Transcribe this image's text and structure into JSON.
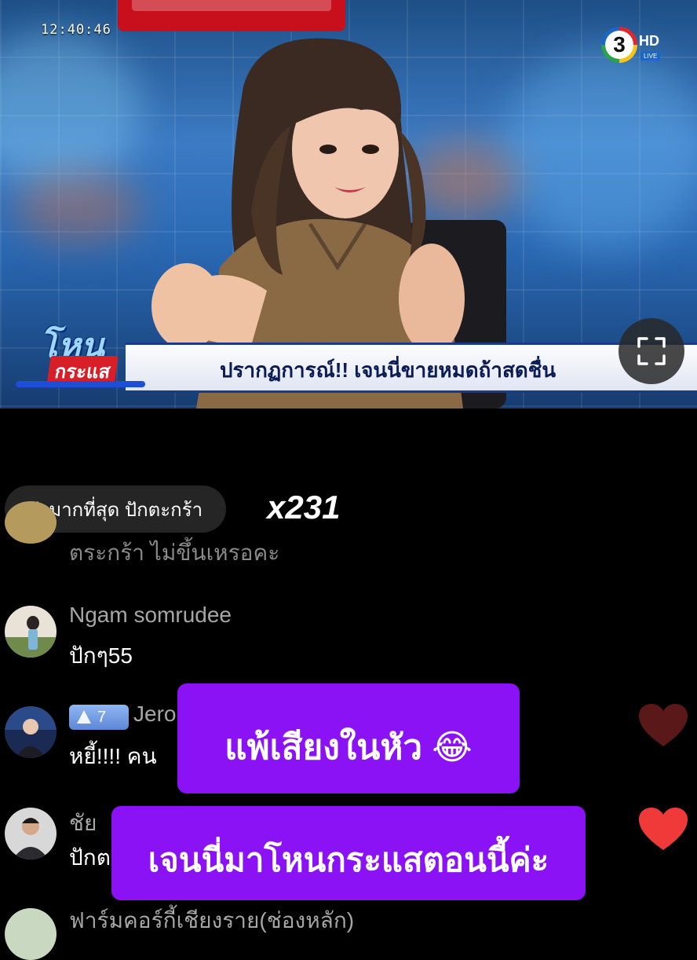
{
  "video": {
    "timestamp": "12:40:46",
    "channel_logo": {
      "number": "3",
      "hd": "HD",
      "live": "LIVE"
    },
    "show_logo": {
      "top": "โหน",
      "bottom": "กระแส"
    },
    "ticker_text": "ปรากฏการณ์!!  เจนนี่ขายหมดถ้าสดชื่น",
    "fullscreen_icon": "fullscreen-icon"
  },
  "top_gifter": {
    "label": "ส่งมากที่สุด ปักตะกร้า",
    "combo": "x231"
  },
  "comments": [
    {
      "user": "",
      "message": "ตระกร้า ไม่ขึ้นเหรอคะ"
    },
    {
      "user": "Ngam somrudee",
      "message": "ปักๆ55"
    },
    {
      "user": "Jero",
      "user_tail": ")",
      "badge_level": "7",
      "message": "หยี้!!!! คน"
    },
    {
      "user": "ชัย",
      "message": "ปักต"
    },
    {
      "user": "ฟาร์มคอร์กี้เชียงราย(ช่องหลัก)",
      "message": ""
    }
  ],
  "overlays": {
    "caption_1": "แพ้เสียงในหัว 😂",
    "caption_2": "เจนนี่มาโหนกระแสตอนนี้ค่ะ"
  },
  "colors": {
    "overlay_purple": "#8b12f5",
    "heart_red": "#f03a3a",
    "heart_dim": "#5a1818"
  }
}
